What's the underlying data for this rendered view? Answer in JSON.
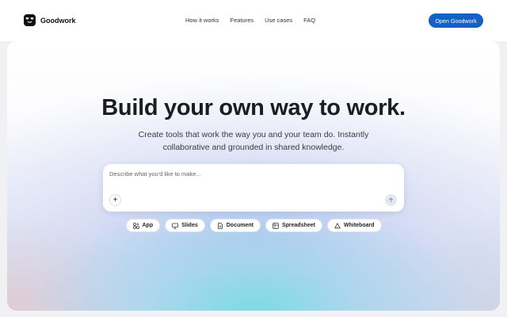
{
  "brand": {
    "name": "Goodwork",
    "icon": "heart-eyes-logo-icon"
  },
  "nav": {
    "items": [
      {
        "label": "How it works"
      },
      {
        "label": "Features"
      },
      {
        "label": "Use cases"
      },
      {
        "label": "FAQ"
      }
    ],
    "cta_label": "Open Goodwork"
  },
  "hero": {
    "title": "Build your own way to work.",
    "subtitle": "Create tools that work the way you and your team do. Instantly collaborative and grounded in shared knowledge."
  },
  "prompt": {
    "placeholder": "Describe what you'd like to make...",
    "value": "",
    "add_icon": "plus-icon",
    "send_icon": "arrow-up-icon"
  },
  "chips": [
    {
      "label": "App",
      "icon": "app-icon"
    },
    {
      "label": "Slides",
      "icon": "slides-icon"
    },
    {
      "label": "Document",
      "icon": "document-icon"
    },
    {
      "label": "Spreadsheet",
      "icon": "spreadsheet-icon"
    },
    {
      "label": "Whiteboard",
      "icon": "whiteboard-icon"
    }
  ],
  "colors": {
    "accent": "#1460c5",
    "text": "#1c1d21"
  }
}
